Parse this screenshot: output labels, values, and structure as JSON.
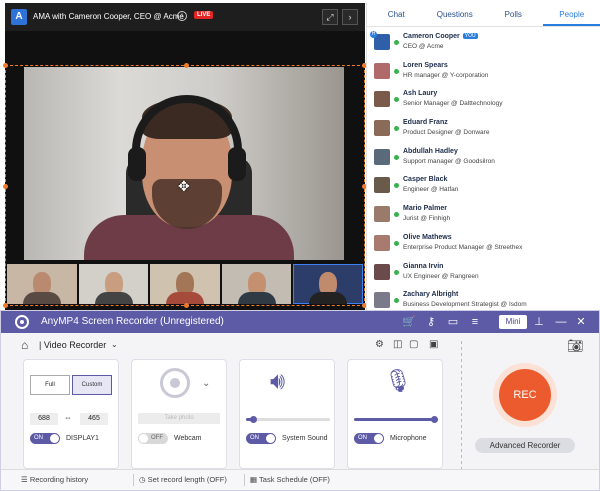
{
  "meeting": {
    "app_logo": "A",
    "title": "AMA with Cameron Cooper, CEO @ Acme",
    "live_badge": "LIVE",
    "icons": [
      "info-icon",
      "expand-icon",
      "chevron-right-icon",
      "move-cursor-icon"
    ]
  },
  "sidebar": {
    "tabs": [
      {
        "label": "Chat",
        "active": false
      },
      {
        "label": "Questions",
        "active": false
      },
      {
        "label": "Polls",
        "active": false
      },
      {
        "label": "People",
        "active": true
      }
    ],
    "you_badge": "YOU",
    "people": [
      {
        "name": "Cameron Cooper",
        "role": "CEO @ Acme",
        "you": true,
        "avatar_color": "#2f5fa8"
      },
      {
        "name": "Loren Spears",
        "role": "HR manager @ Y-corporation",
        "avatar_color": "#b06a6a"
      },
      {
        "name": "Ash Laury",
        "role": "Senior Manager @ Dalttechnology",
        "avatar_color": "#7a5a4a"
      },
      {
        "name": "Eduard Franz",
        "role": "Product Designer @ Donware",
        "avatar_color": "#8a6a58"
      },
      {
        "name": "Abdullah Hadley",
        "role": "Support manager @ Goodsilron",
        "avatar_color": "#5a6a7a"
      },
      {
        "name": "Casper Black",
        "role": "Engineer @ Hatfan",
        "avatar_color": "#6a5a4a"
      },
      {
        "name": "Mario Palmer",
        "role": "Jurist @ Finhigh",
        "avatar_color": "#9a7a6a"
      },
      {
        "name": "Olive Mathews",
        "role": "Enterprise Product Manager @ Streethex",
        "avatar_color": "#a87a70"
      },
      {
        "name": "Gianna Irvin",
        "role": "UX Engineer @ Rangreen",
        "avatar_color": "#6a4a4a"
      },
      {
        "name": "Zachary Albright",
        "role": "Business Development Strategist @ Isdom",
        "avatar_color": "#7a7a8a"
      }
    ]
  },
  "recorder": {
    "title": "AnyMP4 Screen Recorder (Unregistered)",
    "mini_label": "Mini",
    "titlebar_icons": [
      "cart-icon",
      "key-icon",
      "feedback-icon",
      "menu-icon",
      "pin-icon",
      "minimize-icon",
      "close-icon"
    ],
    "mode_label": "| Video Recorder",
    "tools_icons": [
      "settings-icon",
      "mouse-icon",
      "snapshot-icon",
      "ocr-icon"
    ],
    "display": {
      "full_label": "Full",
      "custom_label": "Custom",
      "width": "688",
      "height": "465",
      "toggle": "ON",
      "display_name": "DISPLAY1"
    },
    "webcam": {
      "take_photo": "Take photo",
      "toggle": "OFF",
      "label": "Webcam"
    },
    "system_sound": {
      "toggle": "ON",
      "label": "System Sound",
      "volume": 0.08
    },
    "microphone": {
      "toggle": "ON",
      "label": "Microphone",
      "volume": 0.95
    },
    "rec_label": "REC",
    "advanced_label": "Advanced Recorder",
    "status_bar": {
      "history": "Recording history",
      "record_length": "Set record length (OFF)",
      "task_schedule": "Task Schedule (OFF)"
    },
    "accent_color": "#5d5aa6",
    "rec_color": "#ec5b2d"
  }
}
